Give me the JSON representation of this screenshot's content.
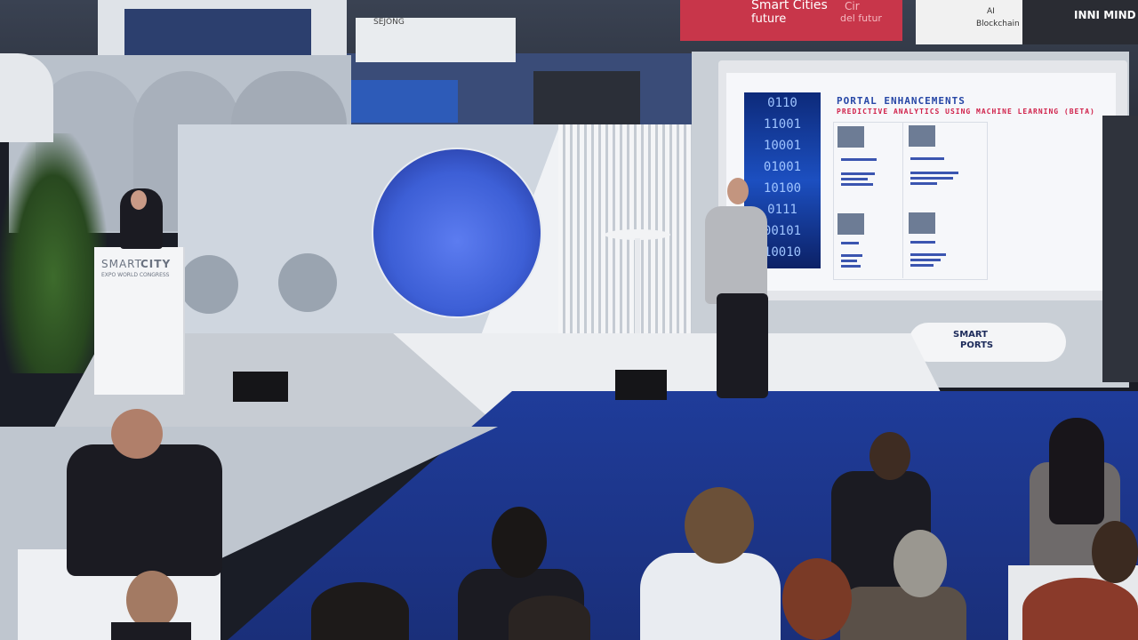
{
  "podium": {
    "brand_word1": "SMART",
    "brand_word2": "CITY",
    "brand_sub": "EXPO WORLD CONGRESS"
  },
  "slide": {
    "title": "PORTAL ENHANCEMENTS",
    "subtitle": "PREDICTIVE ANALYTICS USING MACHINE LEARNING (BETA)",
    "binary_rows": [
      "0110",
      "11001",
      "10001",
      "01001",
      "10100",
      "0111",
      "00101",
      "10010"
    ]
  },
  "banner": {
    "line1": "Smart Cities",
    "line2": "future",
    "faint_word": "Cir",
    "faint_line2": "del futur"
  },
  "booth_sign": {
    "brand": "SEJONG"
  },
  "right_sign": {
    "line1": "AI",
    "line2": "Blockchain",
    "brand": "INNI MIND"
  },
  "stage_logo": {
    "word1": "SMART",
    "word2": "PORTS"
  },
  "colors": {
    "floor": "#1f3c9a",
    "accent_blue": "#2747a6",
    "accent_red": "#d0214a",
    "circle": "#3d5fd6"
  }
}
